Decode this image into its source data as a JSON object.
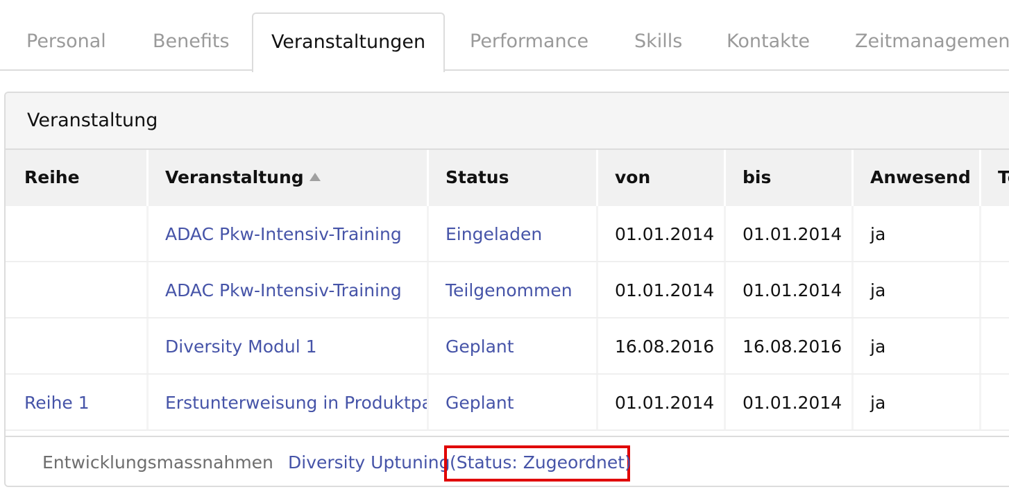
{
  "tabs": [
    {
      "label": "Personal",
      "active": false
    },
    {
      "label": "Benefits",
      "active": false
    },
    {
      "label": "Veranstaltungen",
      "active": true
    },
    {
      "label": "Performance",
      "active": false
    },
    {
      "label": "Skills",
      "active": false
    },
    {
      "label": "Kontakte",
      "active": false
    },
    {
      "label": "Zeitmanagement",
      "active": false
    }
  ],
  "panel": {
    "title": "Veranstaltung"
  },
  "table": {
    "columns": [
      "Reihe",
      "Veranstaltung",
      "Status",
      "von",
      "bis",
      "Anwesend",
      "Te"
    ],
    "sort_icon": "sort-asc-icon",
    "rows": [
      {
        "reihe": "",
        "veranstaltung": "ADAC Pkw-Intensiv-Training",
        "status": "Eingeladen",
        "von": "01.01.2014",
        "bis": "01.01.2014",
        "anwesend": "ja"
      },
      {
        "reihe": "",
        "veranstaltung": "ADAC Pkw-Intensiv-Training",
        "status": "Teilgenommen",
        "von": "01.01.2014",
        "bis": "01.01.2014",
        "anwesend": "ja"
      },
      {
        "reihe": "",
        "veranstaltung": "Diversity Modul 1",
        "status": "Geplant",
        "von": "16.08.2016",
        "bis": "16.08.2016",
        "anwesend": "ja"
      },
      {
        "reihe": "Reihe 1",
        "veranstaltung": "Erstunterweisung in Produktpa",
        "status": "Geplant",
        "von": "01.01.2014",
        "bis": "01.01.2014",
        "anwesend": "ja"
      }
    ]
  },
  "footer": {
    "label": "Entwicklungsmassnahmen",
    "link": "Diversity Uptuning",
    "status": "(Status: Zugeordnet)",
    "highlight_color": "#e00000"
  },
  "colors": {
    "link": "#4654a8",
    "inactive_tab": "#9a9a9a"
  }
}
